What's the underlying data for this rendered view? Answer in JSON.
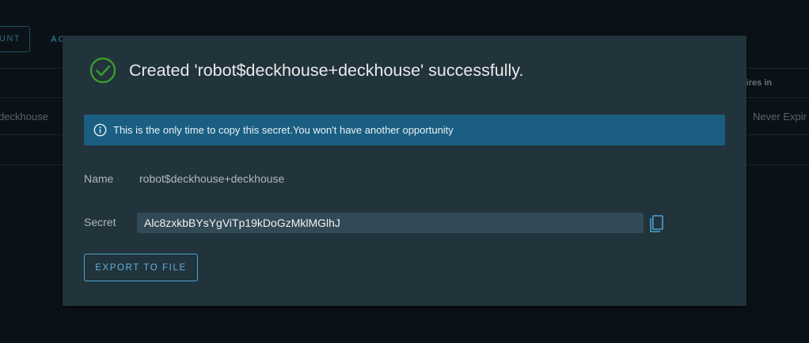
{
  "background": {
    "button_label": "UNT",
    "tab_label": "AC",
    "column_expires": "pires in",
    "row_name": "deckhouse",
    "row_expires": "Never Expir"
  },
  "modal": {
    "title": "Created 'robot$deckhouse+deckhouse' successfully.",
    "alert_text": "This is the only time to copy this secret.You won't have another opportunity",
    "name_label": "Name",
    "name_value": "robot$deckhouse+deckhouse",
    "secret_label": "Secret",
    "secret_value": "Alc8zxkbBYsYgViTp19kDoGzMklMGlhJ",
    "export_label": "EXPORT TO FILE"
  },
  "colors": {
    "modal_bg": "#21333b",
    "alert_bg": "#1a5f82",
    "success_green": "#3c9a2e",
    "accent_blue": "#4aa3d0"
  },
  "icons": {
    "success": "check-circle-icon",
    "info": "info-circle-icon",
    "copy": "copy-icon"
  }
}
